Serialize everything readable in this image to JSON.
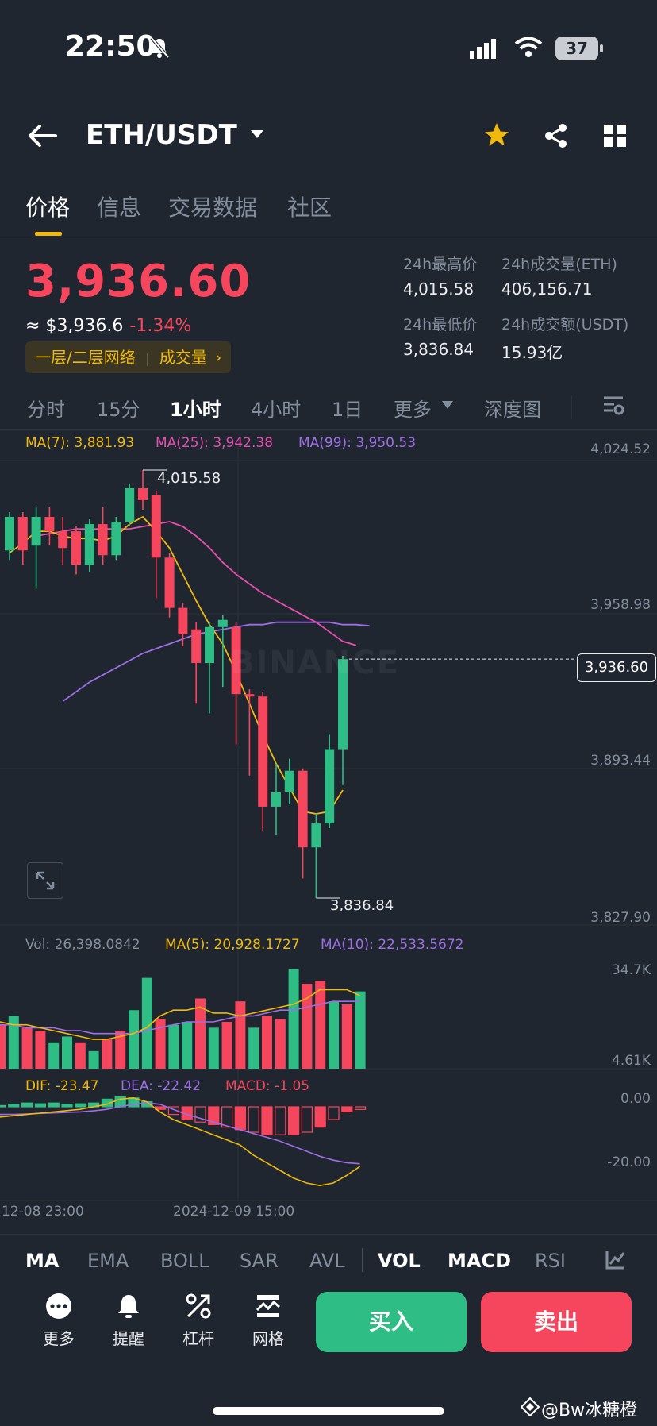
{
  "status_bar": {
    "time": "22:50",
    "battery": "37"
  },
  "header": {
    "pair": "ETH/USDT"
  },
  "tabs": [
    {
      "label": "价格"
    },
    {
      "label": "信息"
    },
    {
      "label": "交易数据"
    },
    {
      "label": "社区"
    }
  ],
  "ticker": {
    "last_price": "3,936.60",
    "usd_approx": "≈ $3,936.6",
    "change": "-1.34%",
    "badge_network": "一层/二层网络",
    "badge_volume": "成交量",
    "stats": {
      "high_label": "24h最高价",
      "high_value": "4,015.58",
      "vol_eth_label": "24h成交量(ETH)",
      "vol_eth_value": "406,156.71",
      "low_label": "24h最低价",
      "low_value": "3,836.84",
      "vol_usdt_label": "24h成交额(USDT)",
      "vol_usdt_value": "15.93亿"
    }
  },
  "intervals": [
    "分时",
    "15分",
    "1小时",
    "4小时",
    "1日",
    "更多",
    "深度图"
  ],
  "chart": {
    "ma_legend": {
      "ma7": "MA(7): 3,881.93",
      "ma25": "MA(25): 3,942.38",
      "ma99": "MA(99): 3,950.53"
    },
    "price_axis": [
      "4,024.52",
      "3,958.98",
      "3,893.44",
      "3,827.90"
    ],
    "current_price": "3,936.60",
    "high_marker": "4,015.58",
    "low_marker": "3,836.84",
    "watermark": "BINANCE",
    "vol_legend": {
      "vol": "Vol: 26,398.0842",
      "ma5": "MA(5): 20,928.1727",
      "ma10": "MA(10): 22,533.5672"
    },
    "vol_axis": [
      "34.7K",
      "4.61K"
    ],
    "macd_legend": {
      "dif": "DIF: -23.47",
      "dea": "DEA: -22.42",
      "macd": "MACD: -1.05"
    },
    "macd_axis": [
      "0.00",
      "-20.00"
    ],
    "time_axis": [
      "12-08 23:00",
      "2024-12-09 15:00"
    ],
    "colors": {
      "up": "#2ebd85",
      "down": "#f6465d",
      "ma7": "#f0b90b",
      "ma25": "#e84fb0",
      "ma99": "#9f6ee6"
    }
  },
  "chart_data": {
    "type": "candlestick",
    "ylim": [
      3827.9,
      4024.52
    ],
    "candles": [
      {
        "o": 3982,
        "c": 3996,
        "h": 3998,
        "l": 3978
      },
      {
        "o": 3996,
        "c": 3982,
        "h": 3998,
        "l": 3976
      },
      {
        "o": 3984,
        "c": 3996,
        "h": 4000,
        "l": 3966
      },
      {
        "o": 3996,
        "c": 3990,
        "h": 4000,
        "l": 3984
      },
      {
        "o": 3990,
        "c": 3983,
        "h": 3996,
        "l": 3976
      },
      {
        "o": 3990,
        "c": 3976,
        "h": 3992,
        "l": 3972
      },
      {
        "o": 3976,
        "c": 3993,
        "h": 3995,
        "l": 3973
      },
      {
        "o": 3993,
        "c": 3980,
        "h": 4000,
        "l": 3976
      },
      {
        "o": 3980,
        "c": 3994,
        "h": 3996,
        "l": 3978
      },
      {
        "o": 3994,
        "c": 4008,
        "h": 4010,
        "l": 3992
      },
      {
        "o": 4008,
        "c": 4003,
        "h": 4015.58,
        "l": 3999
      },
      {
        "o": 4005,
        "c": 3979,
        "h": 4007,
        "l": 3962
      },
      {
        "o": 3979,
        "c": 3958,
        "h": 3981,
        "l": 3954
      },
      {
        "o": 3958,
        "c": 3947,
        "h": 3960,
        "l": 3942
      },
      {
        "o": 3949,
        "c": 3935,
        "h": 3952,
        "l": 3918
      },
      {
        "o": 3935,
        "c": 3950,
        "h": 3952,
        "l": 3914
      },
      {
        "o": 3950,
        "c": 3953,
        "h": 3955,
        "l": 3925
      },
      {
        "o": 3950,
        "c": 3922,
        "h": 3952,
        "l": 3901
      },
      {
        "o": 3922,
        "c": 3921,
        "h": 3924,
        "l": 3888
      },
      {
        "o": 3921,
        "c": 3875,
        "h": 3923,
        "l": 3865
      },
      {
        "o": 3875,
        "c": 3881,
        "h": 3893,
        "l": 3863
      },
      {
        "o": 3881,
        "c": 3890,
        "h": 3895,
        "l": 3876
      },
      {
        "o": 3890,
        "c": 3858,
        "h": 3891,
        "l": 3845
      },
      {
        "o": 3858,
        "c": 3868,
        "h": 3872,
        "l": 3836.84
      },
      {
        "o": 3868,
        "c": 3899,
        "h": 3905,
        "l": 3866
      },
      {
        "o": 3899,
        "c": 3936.6,
        "h": 3938,
        "l": 3884
      }
    ],
    "ma7": [
      3981,
      3985,
      3990,
      3990,
      3988,
      3987,
      3987,
      3986,
      3988,
      3993,
      3996,
      3990,
      3983,
      3972,
      3961,
      3951,
      3943,
      3931,
      3918,
      3905,
      3893,
      3883,
      3873,
      3872,
      3873,
      3881.93
    ],
    "ma25": [
      3988,
      3989,
      3990,
      3991,
      3991,
      3991,
      3991,
      3991,
      3992,
      3993,
      3994,
      3992,
      3988,
      3983,
      3977,
      3972,
      3968,
      3964,
      3961,
      3958,
      3955,
      3952,
      3948,
      3944,
      3942.38
    ],
    "ma99": [
      3919,
      3923,
      3927,
      3930,
      3933,
      3936,
      3939,
      3941,
      3943,
      3945,
      3947,
      3948,
      3949,
      3950,
      3951,
      3951,
      3952,
      3952,
      3952,
      3952,
      3952,
      3951,
      3951,
      3950.53
    ],
    "volume": [
      15,
      18,
      14,
      13,
      9,
      11,
      9,
      6,
      10,
      13,
      20,
      31,
      17,
      15,
      16,
      24,
      14,
      16,
      23,
      14,
      18,
      17,
      34,
      29,
      30,
      23,
      22,
      26.4
    ],
    "vol_ma5": [
      16,
      15,
      15,
      14,
      13,
      12,
      11,
      10,
      10,
      11,
      12,
      14,
      18,
      20,
      20,
      21,
      19,
      19,
      18,
      19,
      20,
      21,
      22,
      24,
      27,
      27,
      27,
      25
    ],
    "vol_ma10": [
      15,
      15,
      14,
      14,
      14,
      13,
      13,
      12,
      12,
      12,
      12,
      13,
      14,
      15,
      16,
      16,
      16,
      17,
      18,
      18,
      19,
      20,
      20,
      21,
      22,
      23,
      23,
      23
    ],
    "macd_hist": [
      0.5,
      1,
      1.5,
      1.2,
      1.5,
      1,
      1.2,
      1.5,
      3,
      4,
      3.5,
      2,
      -1,
      -3,
      -5,
      -6,
      -7,
      -8,
      -9,
      -10,
      -11,
      -11,
      -11,
      -10,
      -8,
      -5,
      -2,
      -1.05
    ],
    "dif": [
      -4,
      -3.5,
      -3,
      -2.5,
      -2,
      -1.5,
      -1,
      0,
      1,
      3,
      3.5,
      2,
      -2,
      -5,
      -7,
      -9,
      -11,
      -13,
      -15,
      -19,
      -22,
      -25,
      -28,
      -30,
      -31,
      -30,
      -27,
      -23.47
    ],
    "dea": [
      -3,
      -3,
      -2.8,
      -2.6,
      -2.4,
      -2.2,
      -2,
      -1.6,
      -1,
      0,
      1,
      1.5,
      1,
      -1,
      -3,
      -4.5,
      -6,
      -7.5,
      -9,
      -10.5,
      -12,
      -13.5,
      -15.5,
      -17.5,
      -19.5,
      -21,
      -22,
      -22.42
    ]
  },
  "bottom_indicators": [
    "MA",
    "EMA",
    "BOLL",
    "SAR",
    "AVL",
    "VOL",
    "MACD",
    "RSI"
  ],
  "actions": [
    {
      "label": "更多",
      "icon": "more-icon"
    },
    {
      "label": "提醒",
      "icon": "bell-icon"
    },
    {
      "label": "杠杆",
      "icon": "leverage-icon"
    },
    {
      "label": "网格",
      "icon": "grid-trading-icon"
    }
  ],
  "buy_label": "买入",
  "sell_label": "卖出",
  "watermark_user": "@Bw冰糖橙"
}
